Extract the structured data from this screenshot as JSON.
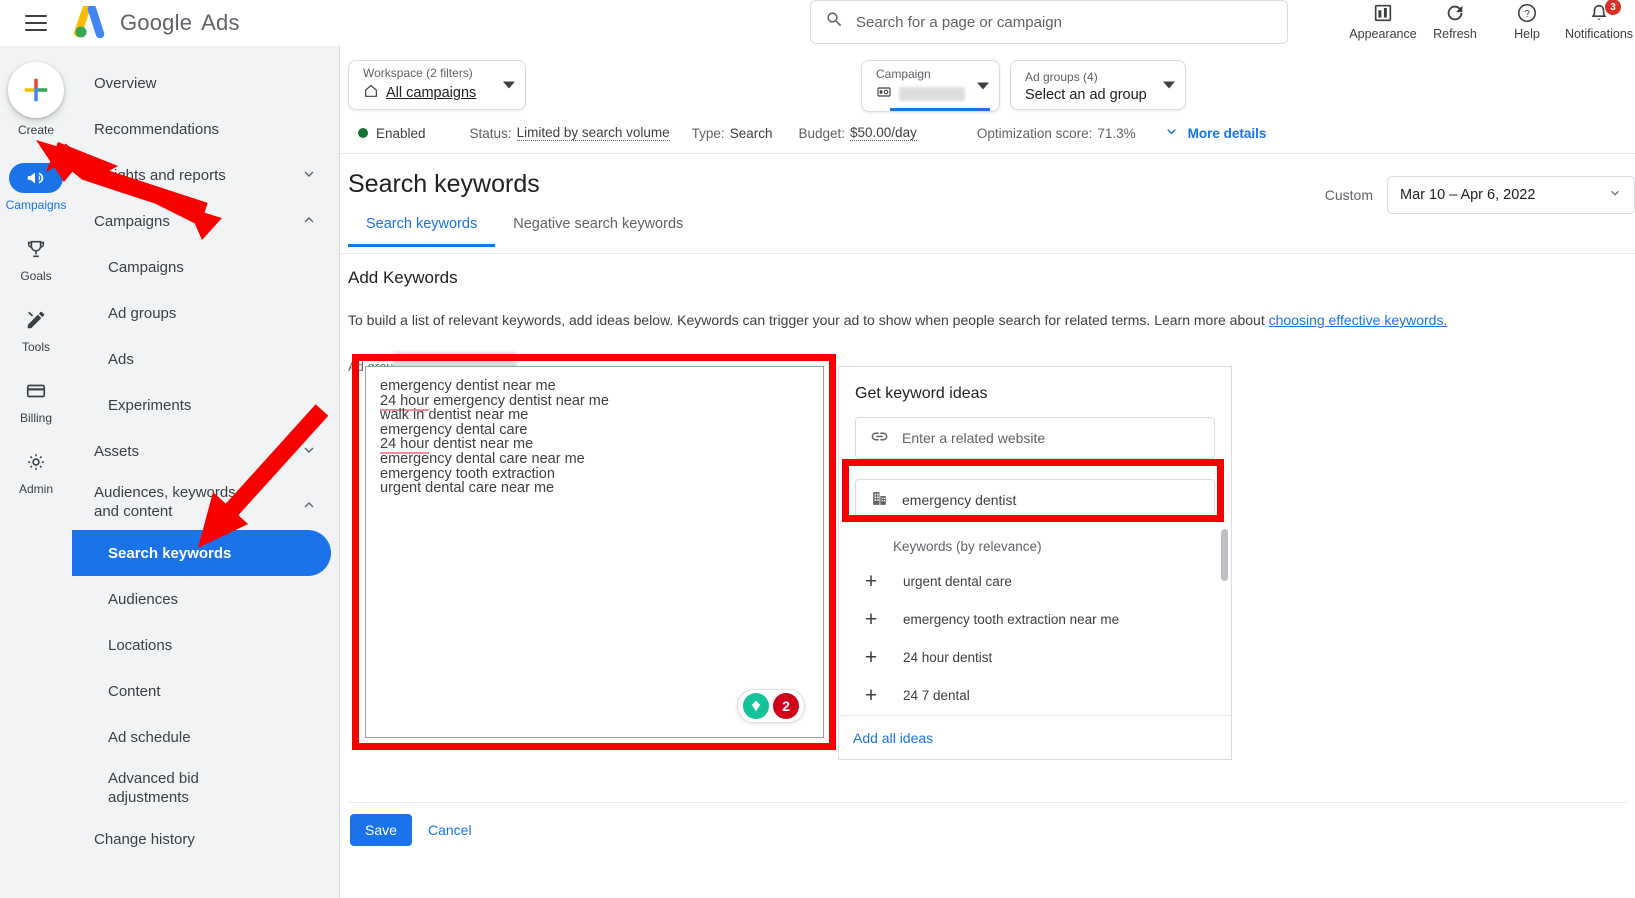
{
  "header": {
    "brand_google": "Google",
    "brand_product": "Ads",
    "search_placeholder": "Search for a page or campaign",
    "icons": [
      {
        "name": "appearance",
        "label": "Appearance"
      },
      {
        "name": "refresh",
        "label": "Refresh"
      },
      {
        "name": "help",
        "label": "Help"
      },
      {
        "name": "notifications",
        "label": "Notifications",
        "badge": "3"
      }
    ]
  },
  "rail": {
    "create_label": "Create",
    "items": [
      {
        "label": "Campaigns",
        "active": true
      },
      {
        "label": "Goals",
        "active": false
      },
      {
        "label": "Tools",
        "active": false
      },
      {
        "label": "Billing",
        "active": false
      },
      {
        "label": "Admin",
        "active": false
      }
    ]
  },
  "sidebar": {
    "items": [
      {
        "label": "Overview",
        "level": 0,
        "chevron": "",
        "active": false
      },
      {
        "label": "Recommendations",
        "level": 0,
        "chevron": "",
        "active": false
      },
      {
        "label": "Insights and reports",
        "level": 0,
        "chevron": "down",
        "active": false
      },
      {
        "label": "Campaigns",
        "level": 0,
        "chevron": "up",
        "active": false
      },
      {
        "label": "Campaigns",
        "level": 1,
        "chevron": "",
        "active": false
      },
      {
        "label": "Ad groups",
        "level": 1,
        "chevron": "",
        "active": false
      },
      {
        "label": "Ads",
        "level": 1,
        "chevron": "",
        "active": false
      },
      {
        "label": "Experiments",
        "level": 1,
        "chevron": "",
        "active": false
      },
      {
        "label": "Assets",
        "level": 0,
        "chevron": "down",
        "active": false
      },
      {
        "label": "Audiences, keywords, and content",
        "level": 0,
        "chevron": "up",
        "active": false
      },
      {
        "label": "Search keywords",
        "level": 1,
        "chevron": "",
        "active": true
      },
      {
        "label": "Audiences",
        "level": 1,
        "chevron": "",
        "active": false
      },
      {
        "label": "Locations",
        "level": 1,
        "chevron": "",
        "active": false
      },
      {
        "label": "Content",
        "level": 1,
        "chevron": "",
        "active": false
      },
      {
        "label": "Ad schedule",
        "level": 1,
        "chevron": "",
        "active": false
      },
      {
        "label": "Advanced bid adjustments",
        "level": 1,
        "chevron": "",
        "active": false
      },
      {
        "label": "Change history",
        "level": 0,
        "chevron": "",
        "active": false
      }
    ]
  },
  "filters": {
    "workspace": {
      "caption": "Workspace (2 filters)",
      "value": "All campaigns"
    },
    "campaign": {
      "caption": "Campaign",
      "value": ""
    },
    "adgroups": {
      "caption": "Ad groups (4)",
      "value": "Select an ad group"
    }
  },
  "status": {
    "state": "Enabled",
    "status_label": "Status:",
    "status_value": "Limited by search volume",
    "type_label": "Type:",
    "type_value": "Search",
    "budget_label": "Budget:",
    "budget_value": "$50.00/day",
    "opt_label": "Optimization score:",
    "opt_value": "71.3%",
    "more_details": "More details"
  },
  "page": {
    "title": "Search keywords",
    "date_preset": "Custom",
    "date_range": "Mar 10 – Apr 6, 2022",
    "tabs": [
      {
        "label": "Search keywords",
        "active": true
      },
      {
        "label": "Negative search keywords",
        "active": false
      }
    ]
  },
  "add_keywords": {
    "heading": "Add Keywords",
    "description": "To build a list of relevant keywords, add ideas below. Keywords can trigger your ad to show when people search for related terms. Learn more about ",
    "link_text": "choosing effective keywords.",
    "ad_group_label": "Ad group",
    "keywords": [
      {
        "text": "emergency dentist near me",
        "spell": null
      },
      {
        "text": "24 hour emergency dentist near me",
        "spell": "24 hour"
      },
      {
        "text": "walk in dentist near me",
        "spell": null
      },
      {
        "text": "emergency dental care",
        "spell": null
      },
      {
        "text": "24 hour dentist near me",
        "spell": "24 hour"
      },
      {
        "text": "emergency dental care near me",
        "spell": null
      },
      {
        "text": "emergency tooth extraction",
        "spell": null
      },
      {
        "text": "urgent dental care near me",
        "spell": null
      }
    ],
    "grammarly_count": "2"
  },
  "ideas": {
    "heading": "Get keyword ideas",
    "website_placeholder": "Enter a related website",
    "seed_value": "emergency dentist",
    "list_header": "Keywords (by relevance)",
    "items": [
      {
        "label": "urgent dental care"
      },
      {
        "label": "emergency tooth extraction near me"
      },
      {
        "label": "24 hour dentist"
      },
      {
        "label": "24 7 dental"
      }
    ],
    "add_all": "Add all ideas"
  },
  "footer": {
    "save_label": "Save",
    "cancel_label": "Cancel"
  },
  "colors": {
    "accent_blue": "#1a73e8",
    "annotation_red": "#f80000",
    "enabled_green": "#137333",
    "notification_red": "#d93025"
  }
}
